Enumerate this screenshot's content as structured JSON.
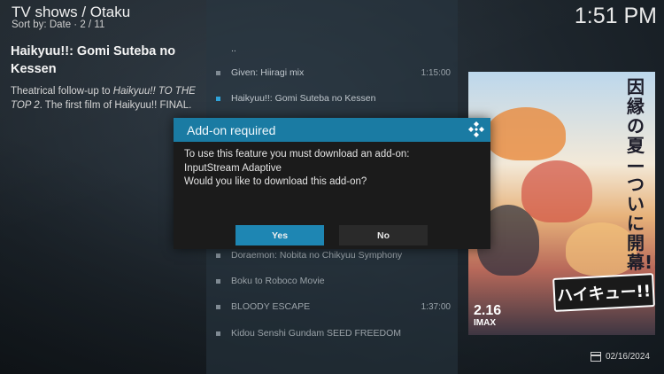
{
  "header": {
    "breadcrumb": "TV shows / Otaku",
    "sort_info": "Sort by: Date  ·  2 / 11",
    "clock": "1:51 PM"
  },
  "info": {
    "title": "Haikyuu!!: Gomi Suteba no Kessen",
    "plot_prefix": "Theatrical follow-up to ",
    "plot_italic": "Haikyuu!! TO THE TOP 2",
    "plot_suffix": ". The first film of Haikyuu!! FINAL."
  },
  "list": {
    "items": [
      {
        "label": "..",
        "time": ""
      },
      {
        "label": "Given: Hiiragi mix",
        "time": "1:15:00"
      },
      {
        "label": "Haikyuu!!: Gomi Suteba no Kessen",
        "time": ""
      },
      {
        "label": "Doraemon: Nobita no Chikyuu Symphony",
        "time": ""
      },
      {
        "label": "Boku to Roboco Movie",
        "time": ""
      },
      {
        "label": "BLOODY ESCAPE",
        "time": "1:37:00"
      },
      {
        "label": "Kidou Senshi Gundam SEED FREEDOM",
        "time": ""
      }
    ]
  },
  "poster": {
    "kanji": "因縁の夏—ついに開幕!!",
    "logo": "ハイキュー!!",
    "date_main": "2.16",
    "date_sub": "IMAX"
  },
  "footer": {
    "date": "02/16/2024"
  },
  "dialog": {
    "title": "Add-on required",
    "line1": "To use this feature you must download an add-on:",
    "line2": "InputStream Adaptive",
    "line3": "Would you like to download this add-on?",
    "yes": "Yes",
    "no": "No"
  },
  "colors": {
    "accent": "#1a7ba3",
    "button_focus": "#1e86b3"
  }
}
